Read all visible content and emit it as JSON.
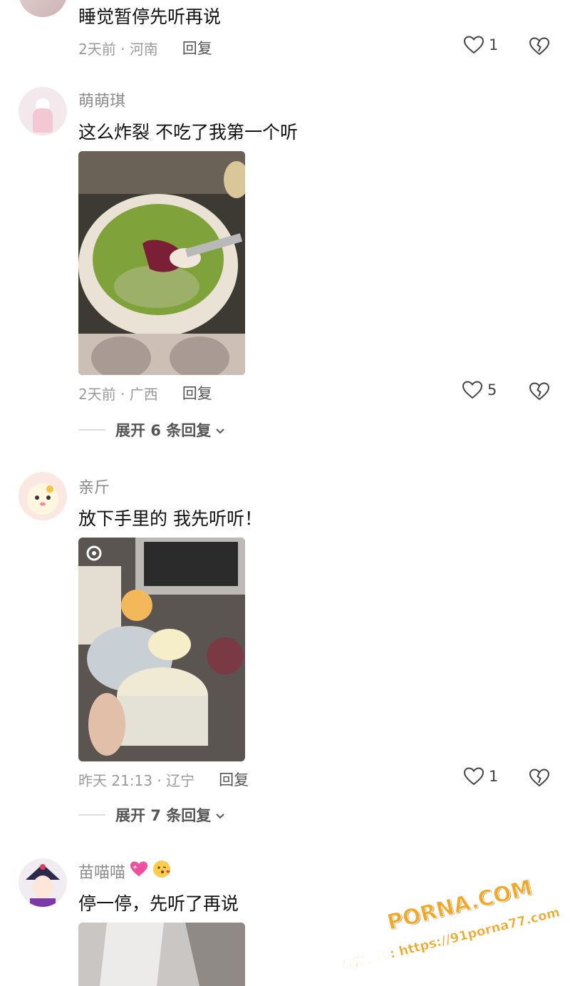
{
  "comments": [
    {
      "content": "睡觉暂停先听再说",
      "time_location": "2天前 · 河南",
      "reply_label": "回复",
      "likes": "1"
    },
    {
      "username": "萌萌琪",
      "content": "这么炸裂 不吃了我第一个听",
      "time_location": "2天前 · 广西",
      "reply_label": "回复",
      "likes": "5",
      "expand_label": "展开 6 条回复"
    },
    {
      "username": "亲斤",
      "content": "放下手里的 我先听听！",
      "time_location": "昨天 21:13 · 辽宁",
      "reply_label": "回复",
      "likes": "1",
      "expand_label": "展开 7 条回复"
    },
    {
      "username": "苗喵喵",
      "content": "停一停，先听了再说"
    }
  ],
  "watermark": {
    "site": "PORNA.COM",
    "line2": "看完整版: https://91porna77.com"
  },
  "colors": {
    "accent": "#f5a623",
    "text": "#111111",
    "meta": "#9a9a9a"
  }
}
